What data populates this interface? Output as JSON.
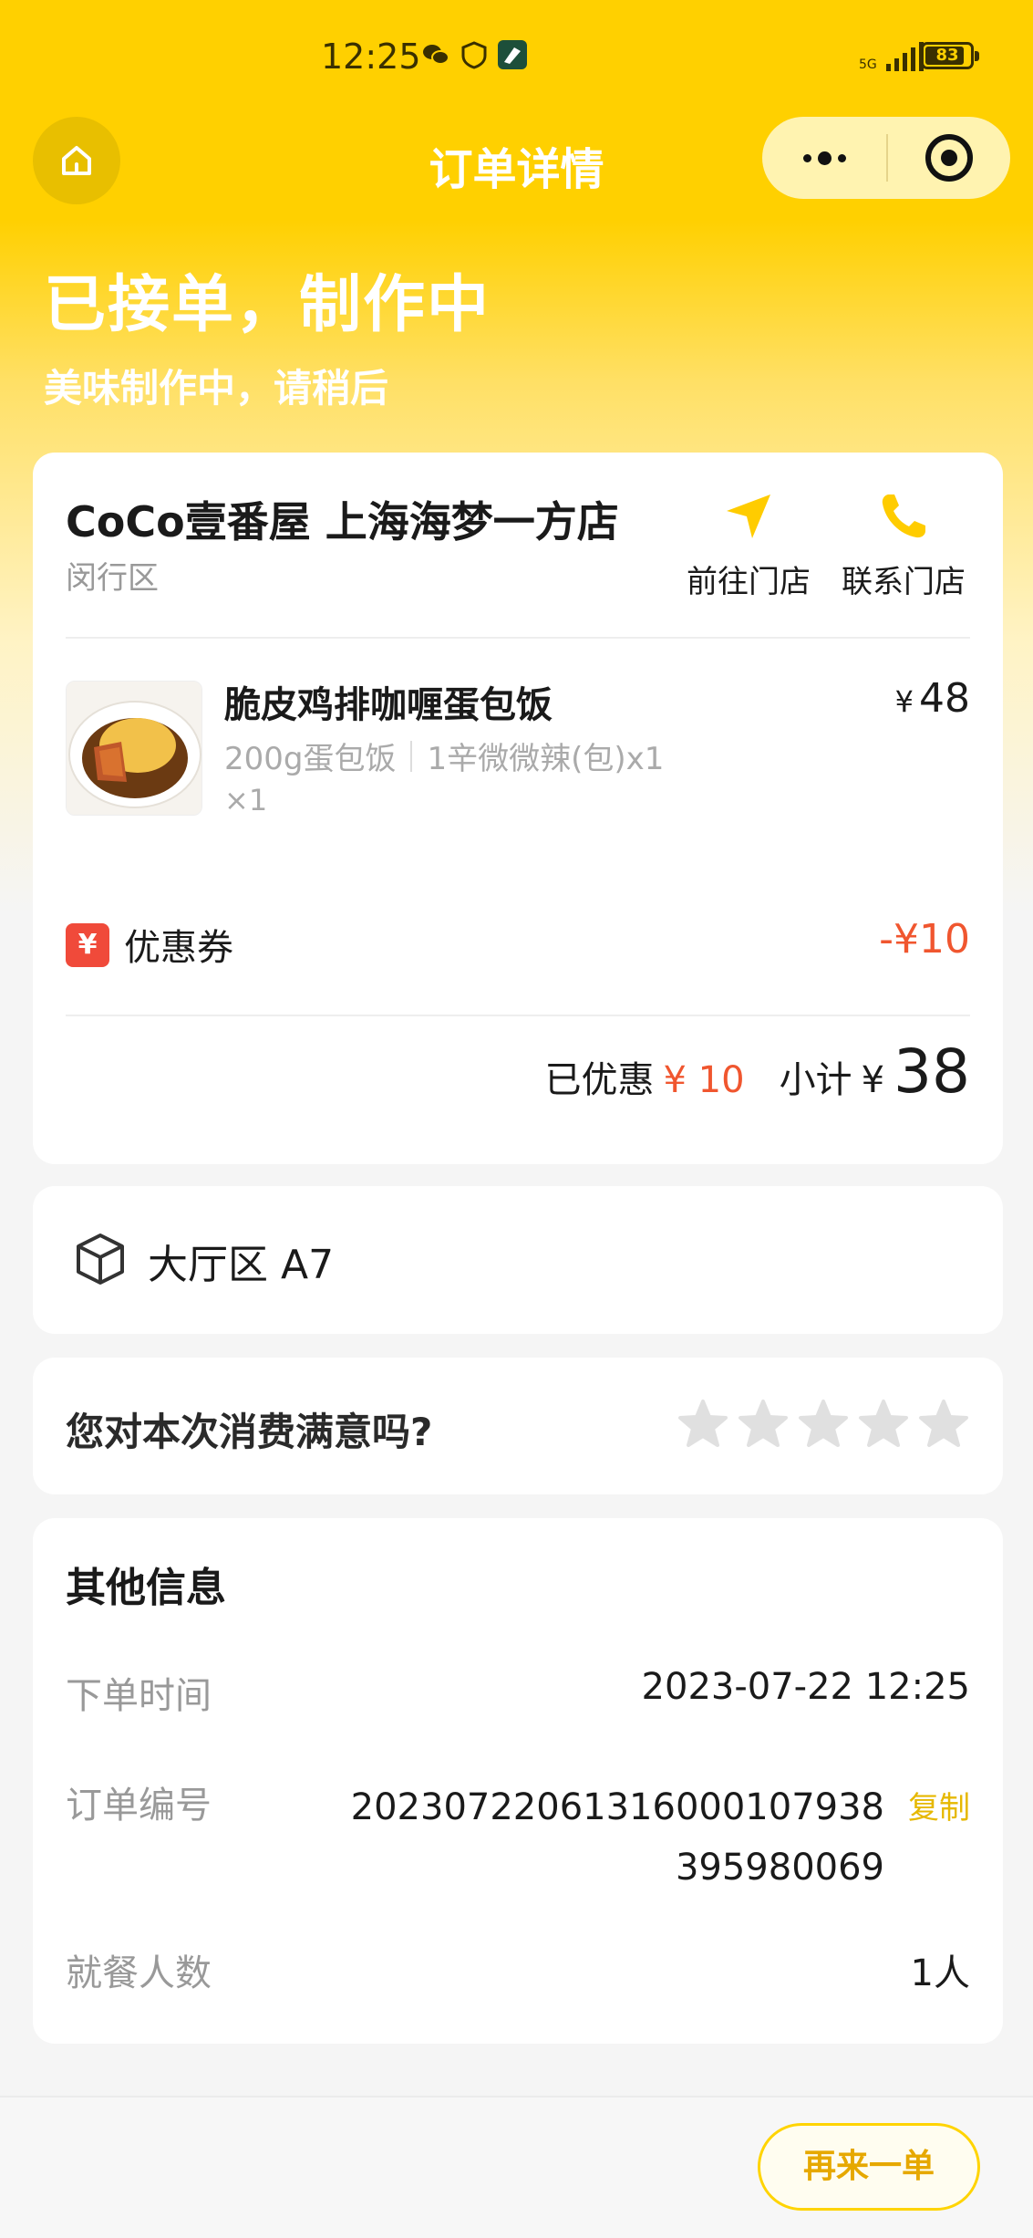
{
  "status_bar": {
    "time": "12:25",
    "network": "5G",
    "battery": "83"
  },
  "nav": {
    "title": "订单详情"
  },
  "order_status": {
    "title": "已接单，制作中",
    "subtitle": "美味制作中，请稍后"
  },
  "store": {
    "name": "CoCo壹番屋 上海海梦一方店",
    "district": "闵行区",
    "navigate_label": "前往门店",
    "call_label": "联系门店"
  },
  "items": [
    {
      "name": "脆皮鸡排咖喱蛋包饭",
      "spec_1": "200g蛋包饭",
      "spec_2": "1辛微微辣(包)x1",
      "qty": "×1",
      "price_symbol": "¥",
      "price": "48"
    }
  ],
  "coupon": {
    "icon_text": "¥",
    "label": "优惠券",
    "amount": "-¥10"
  },
  "summary": {
    "discount_label": "已优惠",
    "discount_value": "¥ 10",
    "subtotal_label": "小计",
    "currency": "¥",
    "subtotal_value": "38"
  },
  "table": {
    "text": "大厅区 A7"
  },
  "rating": {
    "question": "您对本次消费满意吗?",
    "stars_total": 5,
    "stars_selected": 0
  },
  "other_info": {
    "title": "其他信息",
    "order_time_label": "下单时间",
    "order_time_value": "2023-07-22 12:25",
    "order_no_label": "订单编号",
    "order_no_line1": "2023072206131600010793​8",
    "order_no_line2": "395980069",
    "copy_label": "复制",
    "guests_label": "就餐人数",
    "guests_value": "1人"
  },
  "footer": {
    "reorder_label": "再来一单"
  },
  "colors": {
    "brand_yellow": "#ffd000",
    "discount_red": "#f0562f",
    "copy_gold": "#e6b800"
  }
}
